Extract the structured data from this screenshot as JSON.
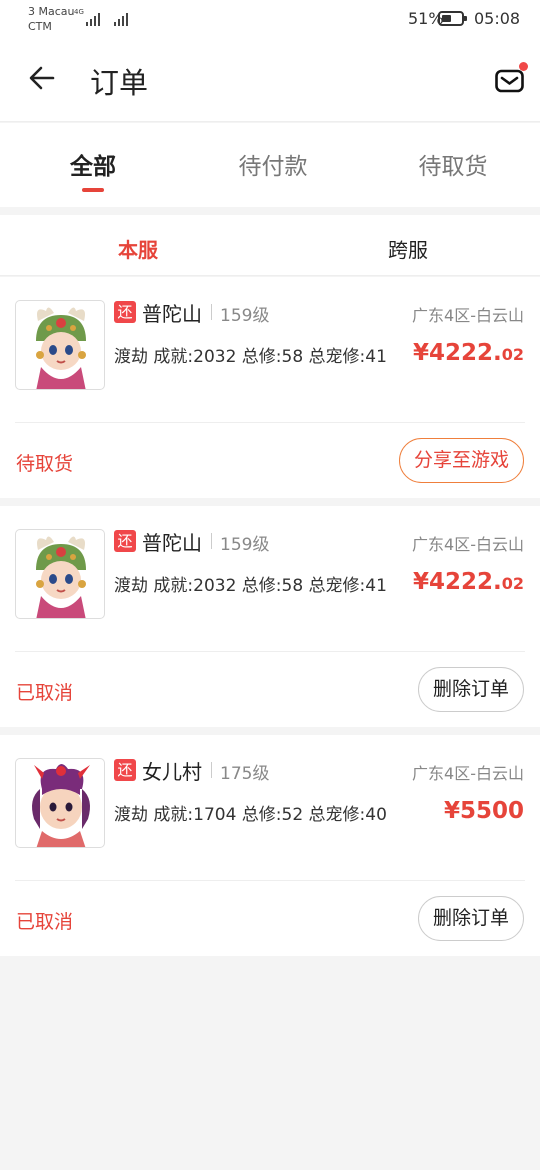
{
  "status_bar": {
    "carrier": "3 Macau CTM",
    "network": "4G",
    "battery": "51%",
    "battery_level": 0.51,
    "time": "05:08"
  },
  "header": {
    "title": "订单",
    "back_icon": "back-arrow-icon",
    "mail_icon": "mail-icon"
  },
  "tabs": [
    {
      "label": "全部",
      "active": true
    },
    {
      "label": "待付款",
      "active": false
    },
    {
      "label": "待取货",
      "active": false
    }
  ],
  "subtabs": [
    {
      "label": "本服",
      "active": true
    },
    {
      "label": "跨服",
      "active": false
    }
  ],
  "orders": [
    {
      "badge": "还",
      "game": "普陀山",
      "level": "159级",
      "server": "广东4区-白云山",
      "stats": "渡劫  成就:2032  总修:58  总宠修:41",
      "price_main": "¥4222.",
      "price_cents": "02",
      "status": "待取货",
      "action": "分享至游戏"
    },
    {
      "badge": "还",
      "game": "普陀山",
      "level": "159级",
      "server": "广东4区-白云山",
      "stats": "渡劫  成就:2032  总修:58  总宠修:41",
      "price_main": "¥4222.",
      "price_cents": "02",
      "status": "已取消",
      "action": "删除订单"
    },
    {
      "badge": "还",
      "game": "女儿村",
      "level": "175级",
      "server": "广东4区-白云山",
      "stats": "渡劫  成就:1704  总修:52  总宠修:40",
      "price_main": "¥5500",
      "price_cents": "",
      "status": "已取消",
      "action": "删除订单"
    }
  ],
  "colors": {
    "accent": "#e6443a",
    "share_border": "#ef7f3c",
    "badge": "#f0474a"
  }
}
